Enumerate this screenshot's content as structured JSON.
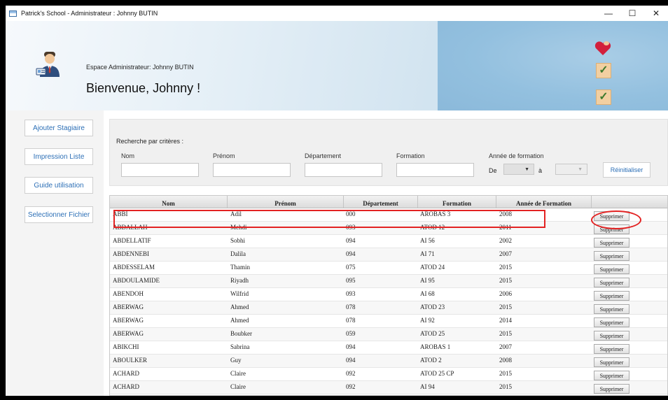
{
  "window": {
    "title": "Patrick's School - Administrateur : Johnny BUTIN",
    "controls": {
      "minimize": "—",
      "maximize": "☐",
      "close": "✕"
    }
  },
  "header": {
    "espace": "Espace Administrateur: Johnny BUTIN",
    "welcome": "Bienvenue, Johnny !"
  },
  "sidebar": {
    "items": [
      {
        "label": "Ajouter Stagiaire"
      },
      {
        "label": "Impression Liste"
      },
      {
        "label": "Guide utilisation"
      },
      {
        "label": "Selectionner Fichier"
      }
    ]
  },
  "search": {
    "title": "Recherche par critères :",
    "labels": {
      "nom": "Nom",
      "prenom": "Prénom",
      "departement": "Département",
      "formation": "Formation",
      "annee": "Année de formation",
      "de": "De",
      "a": "à"
    },
    "reset_label": "Réinitialiser"
  },
  "table": {
    "columns": [
      "Nom",
      "Prénom",
      "Département",
      "Formation",
      "Année de Formation"
    ],
    "delete_label": "Supprimer",
    "rows": [
      {
        "nom": "ABBI",
        "prenom": "Adil",
        "dept": "000",
        "formation": "AROBAS 3",
        "annee": "2008"
      },
      {
        "nom": "ABDALLAH",
        "prenom": "Mehdi",
        "dept": "093",
        "formation": "ATOD 12",
        "annee": "2011"
      },
      {
        "nom": "ABDELLATIF",
        "prenom": "Sobhi",
        "dept": "094",
        "formation": "AI 56",
        "annee": "2002"
      },
      {
        "nom": "ABDENNEBI",
        "prenom": "Dalila",
        "dept": "094",
        "formation": "AI 71",
        "annee": "2007"
      },
      {
        "nom": "ABDESSELAM",
        "prenom": "Thamin",
        "dept": "075",
        "formation": "ATOD 24",
        "annee": "2015"
      },
      {
        "nom": "ABDOULAMIDE",
        "prenom": "Riyadh",
        "dept": "095",
        "formation": "AI 95",
        "annee": "2015"
      },
      {
        "nom": "ABENDOH",
        "prenom": "Wilfrid",
        "dept": "093",
        "formation": "AI 68",
        "annee": "2006"
      },
      {
        "nom": "ABERWAG",
        "prenom": "Ahmed",
        "dept": "078",
        "formation": "ATOD 23",
        "annee": "2015"
      },
      {
        "nom": "ABERWAG",
        "prenom": "Ahmed",
        "dept": "078",
        "formation": "AI 92",
        "annee": "2014"
      },
      {
        "nom": "ABERWAG",
        "prenom": "Boubker",
        "dept": "059",
        "formation": "ATOD 25",
        "annee": "2015"
      },
      {
        "nom": "ABIKCHI",
        "prenom": "Sabrina",
        "dept": "094",
        "formation": "AROBAS 1",
        "annee": "2007"
      },
      {
        "nom": "ABOULKER",
        "prenom": "Guy",
        "dept": "094",
        "formation": "ATOD 2",
        "annee": "2008"
      },
      {
        "nom": "ACHARD",
        "prenom": "Claire",
        "dept": "092",
        "formation": "ATOD 25 CP",
        "annee": "2015"
      },
      {
        "nom": "ACHARD",
        "prenom": "Claire",
        "dept": "092",
        "formation": "AI 94",
        "annee": "2015"
      }
    ]
  },
  "colors": {
    "accent_text": "#2c6fb6",
    "annotation": "#e32222",
    "header_blue": "#93c0df",
    "block": "#f2cfa1",
    "check": "#3e7a2e",
    "heart": "#d21f3c"
  },
  "icons": {
    "app": "app-window-icon",
    "admin": "admin-user-icon",
    "check": "check-icon",
    "heart": "heart-icon",
    "dropdown": "chevron-down-icon"
  }
}
